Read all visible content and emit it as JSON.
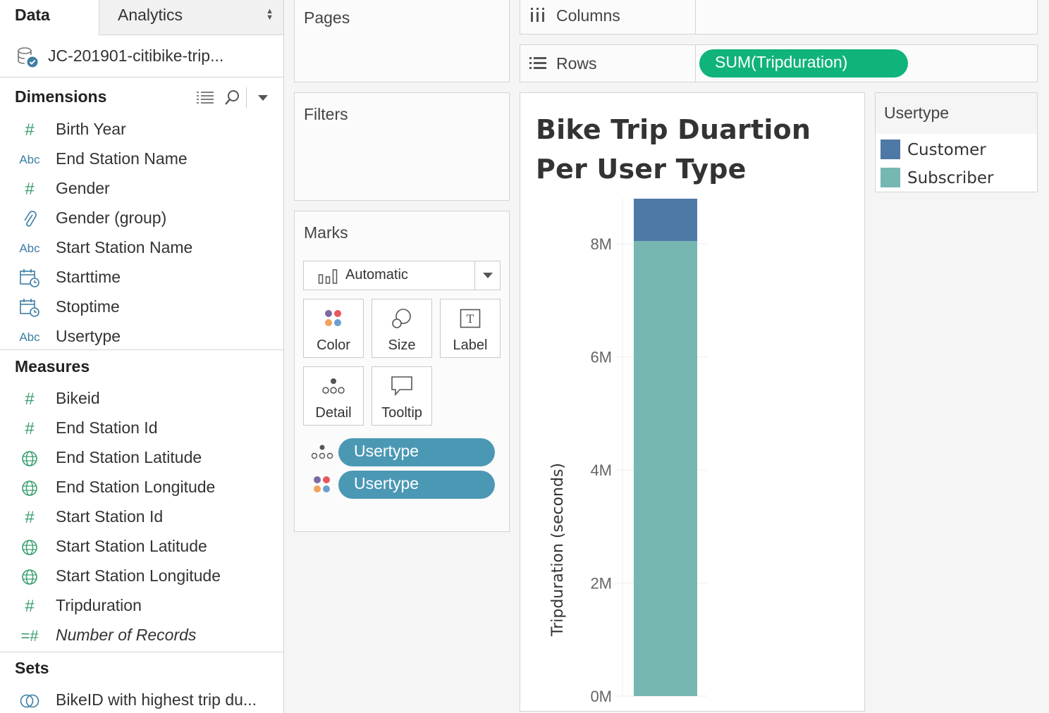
{
  "data_pane": {
    "tabs": {
      "data": "Data",
      "analytics": "Analytics"
    },
    "datasource_name": "JC-201901-citibike-trip...",
    "dimensions": {
      "title": "Dimensions",
      "items": [
        {
          "label": "Birth Year",
          "type": "number"
        },
        {
          "label": "End Station Name",
          "type": "string"
        },
        {
          "label": "Gender",
          "type": "number"
        },
        {
          "label": "Gender (group)",
          "type": "group"
        },
        {
          "label": "Start Station Name",
          "type": "string"
        },
        {
          "label": "Starttime",
          "type": "datetime"
        },
        {
          "label": "Stoptime",
          "type": "datetime"
        },
        {
          "label": "Usertype",
          "type": "string"
        }
      ]
    },
    "measures": {
      "title": "Measures",
      "items": [
        {
          "label": "Bikeid",
          "type": "number"
        },
        {
          "label": "End Station Id",
          "type": "number"
        },
        {
          "label": "End Station Latitude",
          "type": "geo"
        },
        {
          "label": "End Station Longitude",
          "type": "geo"
        },
        {
          "label": "Start Station Id",
          "type": "number"
        },
        {
          "label": "Start Station Latitude",
          "type": "geo"
        },
        {
          "label": "Start Station Longitude",
          "type": "geo"
        },
        {
          "label": "Tripduration",
          "type": "number"
        },
        {
          "label": "Number of Records",
          "type": "calc"
        }
      ]
    },
    "sets": {
      "title": "Sets",
      "items": [
        {
          "label": "BikeID with highest trip du...",
          "type": "set"
        }
      ]
    },
    "abc_glyph": "Abc"
  },
  "cards": {
    "pages": "Pages",
    "filters": "Filters",
    "marks": {
      "title": "Marks",
      "mark_type": "Automatic",
      "buttons": {
        "color": "Color",
        "size": "Size",
        "label": "Label",
        "detail": "Detail",
        "tooltip": "Tooltip"
      },
      "label_glyph": "T",
      "pills": [
        {
          "encoding": "detail",
          "field": "Usertype"
        },
        {
          "encoding": "color",
          "field": "Usertype"
        }
      ]
    }
  },
  "shelves": {
    "columns": {
      "label": "Columns",
      "pills": []
    },
    "rows": {
      "label": "Rows",
      "pills": [
        "SUM(Tripduration)"
      ]
    }
  },
  "colors": {
    "customer": "#4e79a7",
    "subscriber": "#76b7b2",
    "pill_blue": "#4b98b5",
    "pill_green": "#10b37a",
    "field_green": "#3b9e70",
    "field_blue": "#3d7da4"
  },
  "legend": {
    "title": "Usertype",
    "items": [
      {
        "label": "Customer",
        "color": "#4e79a7"
      },
      {
        "label": "Subscriber",
        "color": "#76b7b2"
      }
    ]
  },
  "chart_data": {
    "type": "bar",
    "stacked": true,
    "title": "Bike  Trip Duartion Per User Type",
    "ylabel": "Tripduration (seconds)",
    "xlabel": "",
    "ylim": [
      0,
      8800000
    ],
    "yticks": [
      0,
      2000000,
      4000000,
      6000000,
      8000000
    ],
    "ytick_labels": [
      "0M",
      "2M",
      "4M",
      "6M",
      "8M"
    ],
    "grid": true,
    "legend_position": "right",
    "series": [
      {
        "name": "Subscriber",
        "values": [
          8050000
        ],
        "color": "#76b7b2"
      },
      {
        "name": "Customer",
        "values": [
          750000
        ],
        "color": "#4e79a7"
      }
    ]
  }
}
